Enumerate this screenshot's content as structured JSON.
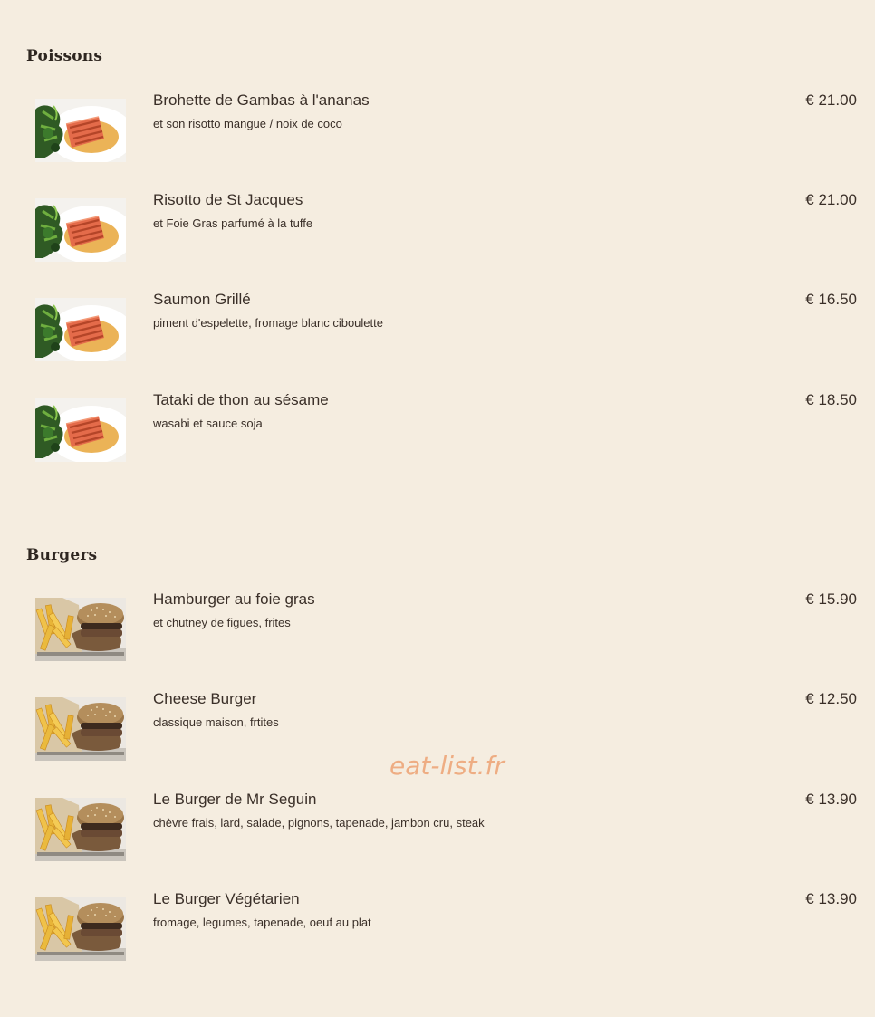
{
  "sections": [
    {
      "title": "Poissons",
      "image_icon": "grilled-salmon-photo",
      "items": [
        {
          "name": "Brohette de Gambas à l'ananas",
          "desc": "et son risotto mangue / noix de coco",
          "price": "€ 21.00"
        },
        {
          "name": "Risotto de St Jacques",
          "desc": "et Foie Gras parfumé à la tuffe",
          "price": "€ 21.00"
        },
        {
          "name": "Saumon Grillé",
          "desc": "piment d'espelette, fromage blanc ciboulette",
          "price": "€ 16.50"
        },
        {
          "name": "Tataki de thon au sésame",
          "desc": "wasabi et sauce soja",
          "price": "€ 18.50"
        }
      ]
    },
    {
      "title": "Burgers",
      "image_icon": "burger-fries-photo",
      "items": [
        {
          "name": "Hamburger au foie gras",
          "desc": "et chutney de figues, frites",
          "price": "€ 15.90"
        },
        {
          "name": "Cheese Burger",
          "desc": "classique maison, frtites",
          "price": "€ 12.50"
        },
        {
          "name": "Le Burger de Mr Seguin",
          "desc": "chèvre frais, lard, salade, pignons, tapenade, jambon cru, steak",
          "price": "€ 13.90"
        },
        {
          "name": "Le Burger Végétarien",
          "desc": "fromage, legumes, tapenade, oeuf au plat",
          "price": "€ 13.90"
        }
      ]
    }
  ],
  "watermark": "eat-list.fr"
}
